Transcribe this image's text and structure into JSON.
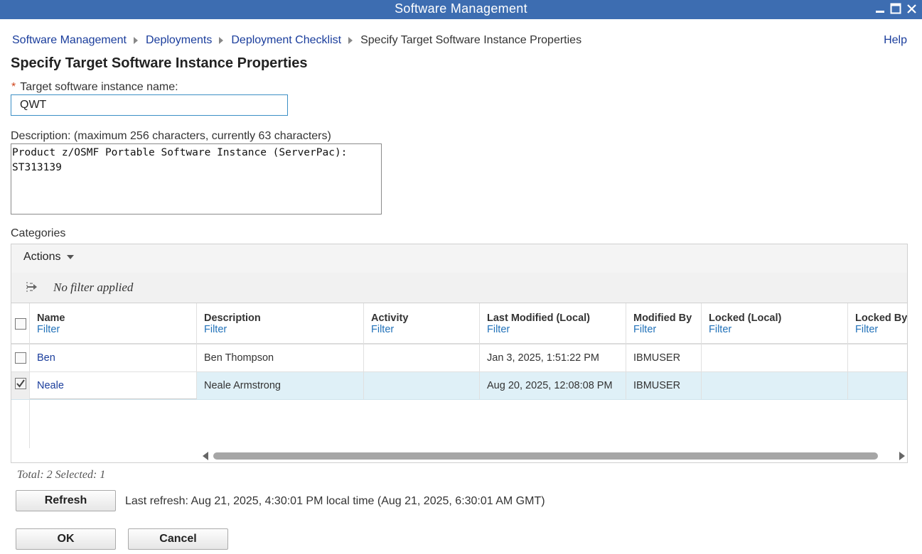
{
  "window": {
    "title": "Software Management"
  },
  "breadcrumb": {
    "items": [
      "Software Management",
      "Deployments",
      "Deployment Checklist"
    ],
    "current": "Specify Target Software Instance Properties"
  },
  "help_label": "Help",
  "page_title": "Specify Target Software Instance Properties",
  "name_field": {
    "required_marker": "*",
    "label": "Target software instance name:",
    "value": "QWT"
  },
  "description_field": {
    "label": "Description: (maximum 256 characters, currently 63 characters)",
    "value": "Product z/OSMF Portable Software Instance (ServerPac):\nST313139"
  },
  "categories": {
    "label": "Categories",
    "actions_label": "Actions",
    "filter_status": "No filter applied",
    "columns": [
      {
        "title": "Name",
        "filter": "Filter"
      },
      {
        "title": "Description",
        "filter": "Filter"
      },
      {
        "title": "Activity",
        "filter": "Filter"
      },
      {
        "title": "Last Modified (Local)",
        "filter": "Filter"
      },
      {
        "title": "Modified By",
        "filter": "Filter"
      },
      {
        "title": "Locked (Local)",
        "filter": "Filter"
      },
      {
        "title": "Locked By",
        "filter": "Filter"
      }
    ],
    "rows": [
      {
        "name": "Ben",
        "description": "Ben Thompson",
        "activity": "",
        "last_modified": "Jan 3, 2025, 1:51:22 PM",
        "modified_by": "IBMUSER",
        "locked": "",
        "locked_by": "",
        "selected": false
      },
      {
        "name": "Neale",
        "description": "Neale Armstrong",
        "activity": "",
        "last_modified": "Aug 20, 2025, 12:08:08 PM",
        "modified_by": "IBMUSER",
        "locked": "",
        "locked_by": "",
        "selected": true
      }
    ],
    "totals": "Total: 2 Selected: 1"
  },
  "refresh": {
    "button_label": "Refresh",
    "last_refresh": "Last refresh: Aug 21, 2025, 4:30:01 PM local time (Aug 21, 2025, 6:30:01 AM GMT)"
  },
  "footer": {
    "ok_label": "OK",
    "cancel_label": "Cancel"
  },
  "colors": {
    "titlebar": "#3d6db1",
    "link": "#1a3d9c",
    "selected_row": "#dff0f7",
    "required": "#d0461d"
  }
}
